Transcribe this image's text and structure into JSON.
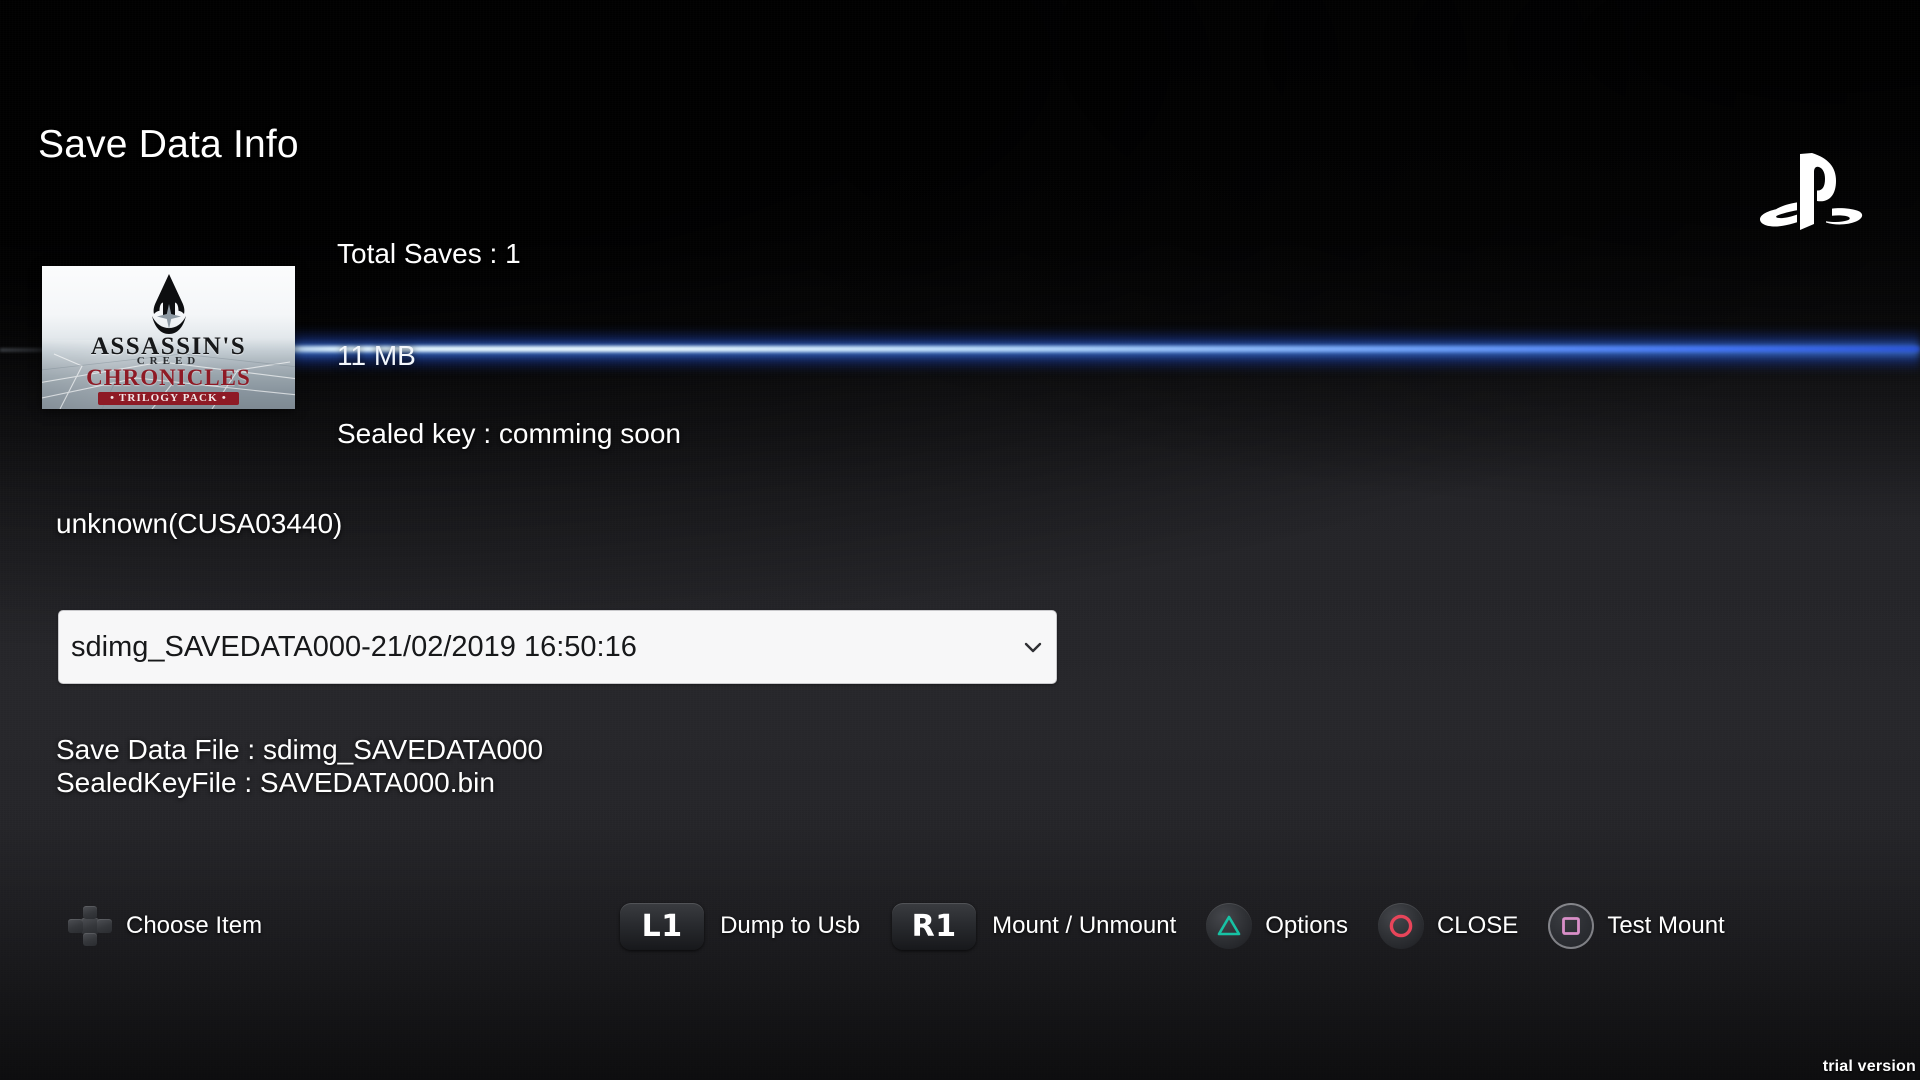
{
  "window": {
    "title": "Save Data Info",
    "trial_watermark": "trial version"
  },
  "branding": {
    "logo": "playstation-logo"
  },
  "cover": {
    "title_line_1": "ASSASSIN'S",
    "title_line_2": "CREED",
    "title_line_3": "CHRONICLES",
    "badge": "• TRILOGY PACK •",
    "emblem": "assassins-creed-emblem"
  },
  "info": {
    "total_saves": "Total Saves : 1",
    "size": "11 MB",
    "sealed_key": "Sealed key : comming soon",
    "title_id": "unknown(CUSA03440)"
  },
  "save_select": {
    "value": "sdimg_SAVEDATA000-21/02/2019 16:50:16",
    "options": [
      "sdimg_SAVEDATA000-21/02/2019 16:50:16"
    ],
    "chevron": "chevron-down-icon"
  },
  "files": {
    "save_data_file": "Save Data File : sdimg_SAVEDATA000",
    "sealed_key_file": "SealedKeyFile : SAVEDATA000.bin"
  },
  "hints": [
    {
      "icon": "dpad-icon",
      "label": "Choose Item"
    },
    {
      "icon": "l1-button",
      "label": "Dump to Usb",
      "glyph": "L1"
    },
    {
      "icon": "r1-button",
      "label": "Mount / Unmount",
      "glyph": "R1"
    },
    {
      "icon": "triangle-button",
      "label": "Options"
    },
    {
      "icon": "circle-button",
      "label": "CLOSE"
    },
    {
      "icon": "square-button",
      "label": "Test Mount"
    }
  ],
  "colors": {
    "beam_core": "#e6f4ff",
    "beam_glow": "#2e6bff",
    "triangle": "#17c2a4",
    "circle": "#e8455a",
    "square": "#d98fc8",
    "background": "#27272b",
    "select_bg": "#f7f7f8"
  }
}
